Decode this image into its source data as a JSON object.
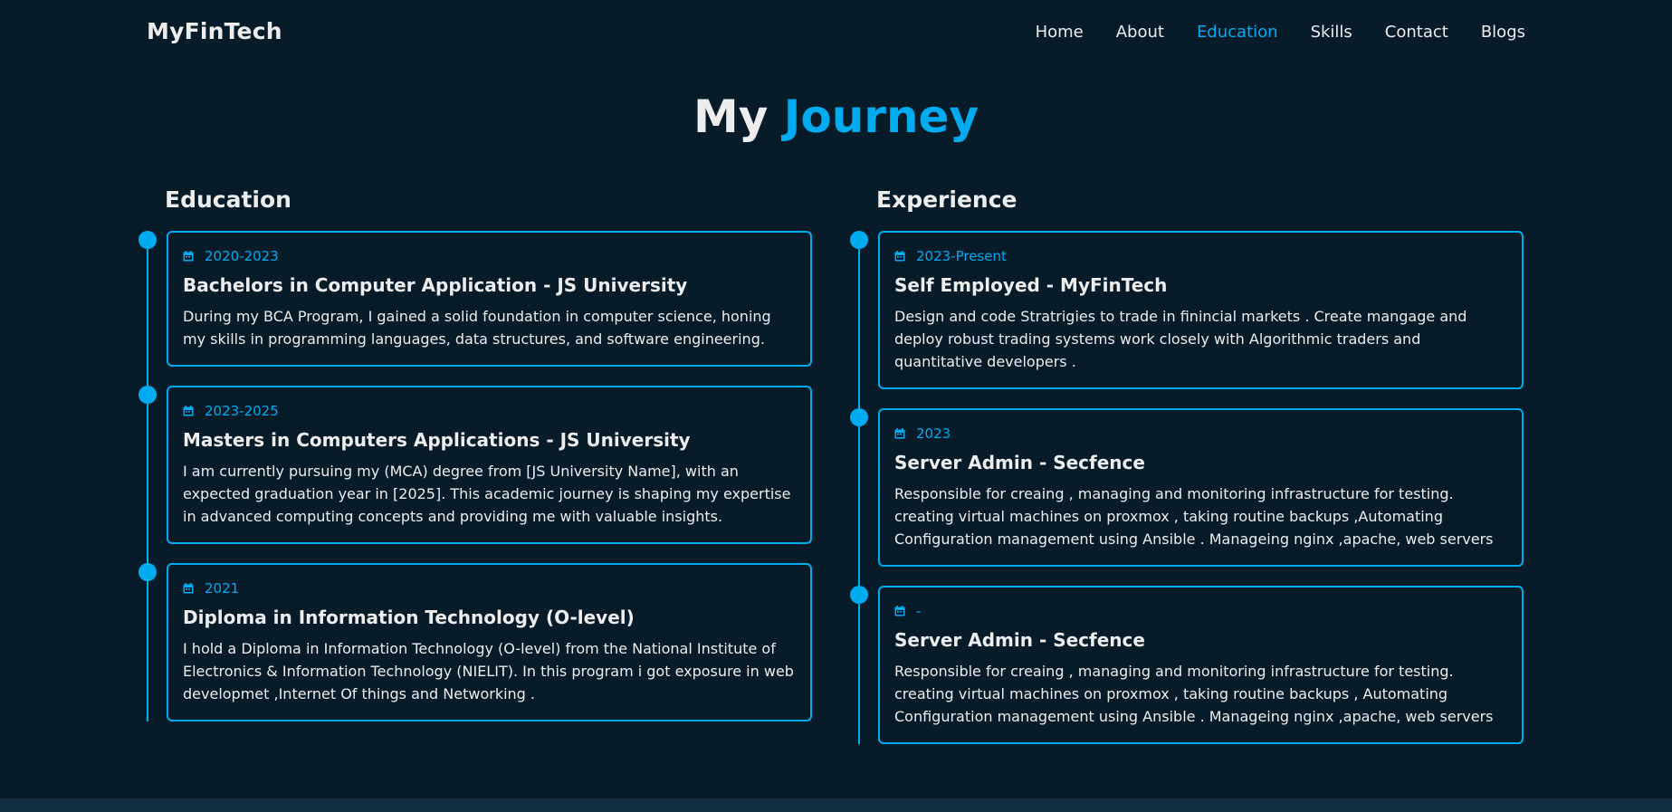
{
  "nav": {
    "logo": "MyFinTech",
    "links": [
      "Home",
      "About",
      "Education",
      "Skills",
      "Contact",
      "Blogs"
    ],
    "active_link": "Education"
  },
  "page": {
    "heading_plain": "My",
    "heading_accent": "Journey"
  },
  "colors": {
    "background": "#081b29",
    "accent": "#00abf0",
    "text": "#ededed",
    "footer_strip": "#112e42"
  },
  "education": {
    "title": "Education",
    "items": [
      {
        "year": "2020-2023",
        "title": "Bachelors in Computer Application - JS University",
        "text": "During my BCA Program, I gained a solid foundation in computer science, honing my skills in programming languages, data structures, and software engineering."
      },
      {
        "year": "2023-2025",
        "title": "Masters in Computers Applications - JS University",
        "text": "I am currently pursuing my (MCA) degree from [JS University Name], with an expected graduation year in [2025]. This academic journey is shaping my expertise in advanced computing concepts and providing me with valuable insights."
      },
      {
        "year": "2021",
        "title": "Diploma in Information Technology (O-level)",
        "text": "I hold a Diploma in Information Technology (O-level) from the National Institute of Electronics & Information Technology (NIELIT). In this program i got exposure in web developmet ,Internet Of things and Networking ."
      }
    ]
  },
  "experience": {
    "title": "Experience",
    "items": [
      {
        "year": "2023-Present",
        "title": "Self Employed - MyFinTech",
        "text": "Design and code Stratrigies to trade in finincial markets . Create mangage and deploy robust trading systems work closely with Algorithmic traders and quantitative developers ."
      },
      {
        "year": "2023",
        "title": "Server Admin - Secfence",
        "text": "Responsible for creaing , managing and monitoring infrastructure for testing. creating virtual machines on proxmox , taking routine backups ,Automating Configuration management using Ansible . Manageing nginx ,apache, web servers"
      },
      {
        "year": "-",
        "title": "Server Admin - Secfence",
        "text": "Responsible for creaing , managing and monitoring infrastructure for testing. creating virtual machines on proxmox , taking routine backups , Automating Configuration management using Ansible . Manageing nginx ,apache, web servers"
      }
    ]
  }
}
